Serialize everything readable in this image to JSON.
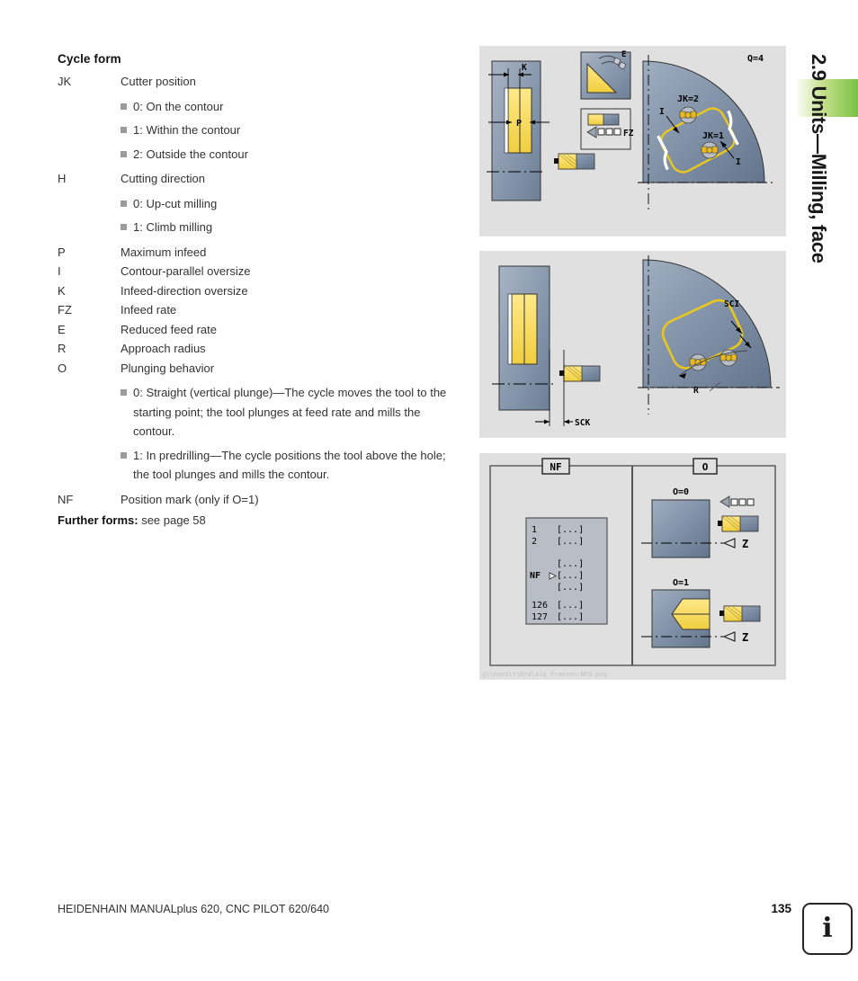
{
  "chapter": {
    "title": "2.9 Units—Milling, face",
    "accent_color": "#7ac143"
  },
  "content": {
    "section_title": "Cycle form",
    "params": [
      {
        "key": "JK",
        "desc": "Cutter position"
      },
      {
        "key": "H",
        "desc": "Cutting direction"
      },
      {
        "key": "P",
        "desc": "Maximum infeed"
      },
      {
        "key": "I",
        "desc": "Contour-parallel oversize"
      },
      {
        "key": "K",
        "desc": "Infeed-direction oversize"
      },
      {
        "key": "FZ",
        "desc": "Infeed rate"
      },
      {
        "key": "E",
        "desc": "Reduced feed rate"
      },
      {
        "key": "R",
        "desc": "Approach radius"
      },
      {
        "key": "O",
        "desc": "Plunging behavior"
      },
      {
        "key": "NF",
        "desc": "Position mark (only if O=1)"
      }
    ],
    "jk_options": [
      "0: On the contour",
      "1: Within the contour",
      "2: Outside the contour"
    ],
    "h_options": [
      "0: Up-cut milling",
      "1: Climb milling"
    ],
    "o_options": [
      "0: Straight (vertical plunge)—The cycle moves the tool to the starting point; the tool plunges at feed rate and mills the contour.",
      "1: In predrilling—The cycle positions the tool above the hole; the tool plunges and mills the contour."
    ],
    "further_forms_label": "Further forms:",
    "further_forms_value": "see page 58"
  },
  "figures": {
    "figure1": {
      "labels": {
        "quadrant": "Q=4",
        "k": "K",
        "p": "P",
        "e": "E",
        "fz": "FZ",
        "jk2": "JK=2",
        "jk1": "JK=1",
        "i_upper": "I",
        "i_lower": "I"
      }
    },
    "figure2": {
      "labels": {
        "sck": "SCK",
        "sci": "SCI",
        "r": "R"
      }
    },
    "figure3": {
      "labels": {
        "nf_panel": "NF",
        "o_panel": "O",
        "o_zero": "O=0",
        "o_one": "O=1",
        "axis_z_top": "Z",
        "axis_z_bottom": "Z",
        "nf_marker": "NF"
      },
      "nf_list": [
        {
          "num": "1",
          "value": "[...]"
        },
        {
          "num": "2",
          "value": "[...]"
        },
        {
          "num": "",
          "value": "[...]"
        },
        {
          "num": "",
          "value": "[...]"
        },
        {
          "num": "",
          "value": "[...]"
        },
        {
          "num": "126",
          "value": "[...]"
        },
        {
          "num": "127",
          "value": "[...]"
        }
      ],
      "watermark": "g\\\\npedit\\Ord\\Alg_Fraesen-NFO.png"
    }
  },
  "footer": {
    "product": "HEIDENHAIN MANUALplus 620, CNC PILOT 620/640",
    "page_number": "135",
    "info_glyph": "i"
  }
}
